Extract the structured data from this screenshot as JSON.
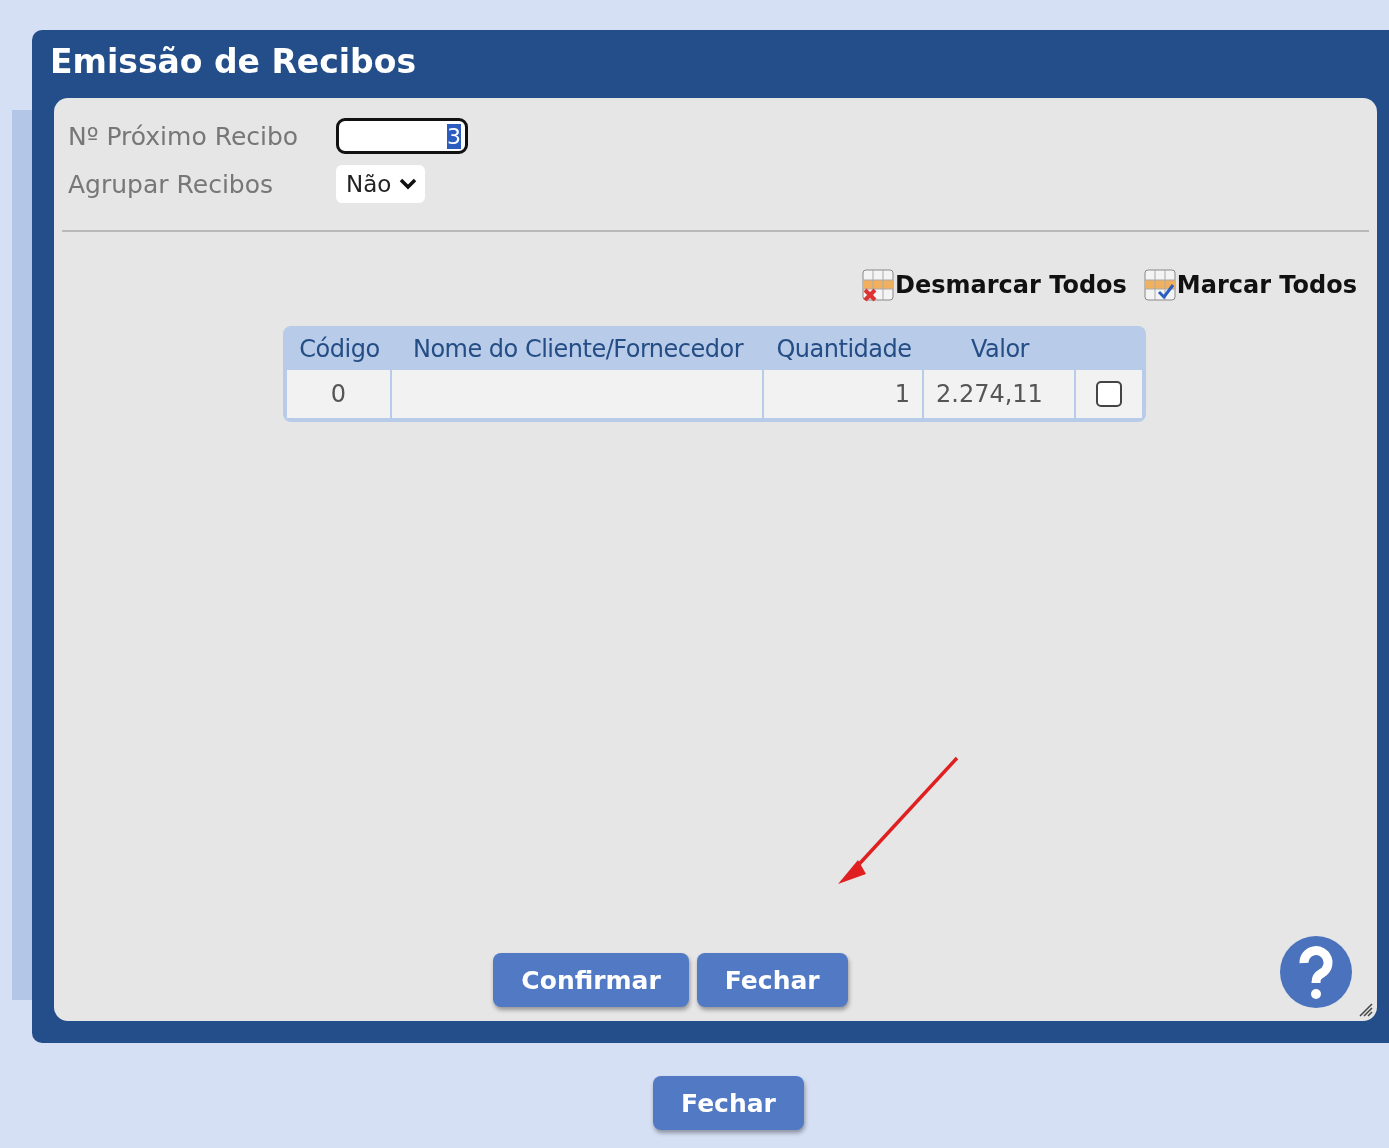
{
  "dialog": {
    "title": "Emissão de Recibos",
    "fields": [
      {
        "label": "Nº Próximo Recibo",
        "kind": "input",
        "value": "3"
      },
      {
        "label": "Agrupar Recibos",
        "kind": "select",
        "value": "Não"
      }
    ],
    "actions": [
      {
        "label": "Desmarcar Todos",
        "kind": "uncheck"
      },
      {
        "label": "Marcar Todos",
        "kind": "check"
      }
    ],
    "table": {
      "columns": [
        "Código",
        "Nome do Cliente/Fornecedor",
        "Quantidade",
        "Valor"
      ],
      "rows": [
        {
          "cells": [
            "0",
            "",
            "1",
            "2.274,11"
          ],
          "checked": false
        }
      ]
    },
    "buttons": [
      "Confirmar",
      "Fechar"
    ]
  },
  "page_buttons": [
    "Fechar"
  ]
}
